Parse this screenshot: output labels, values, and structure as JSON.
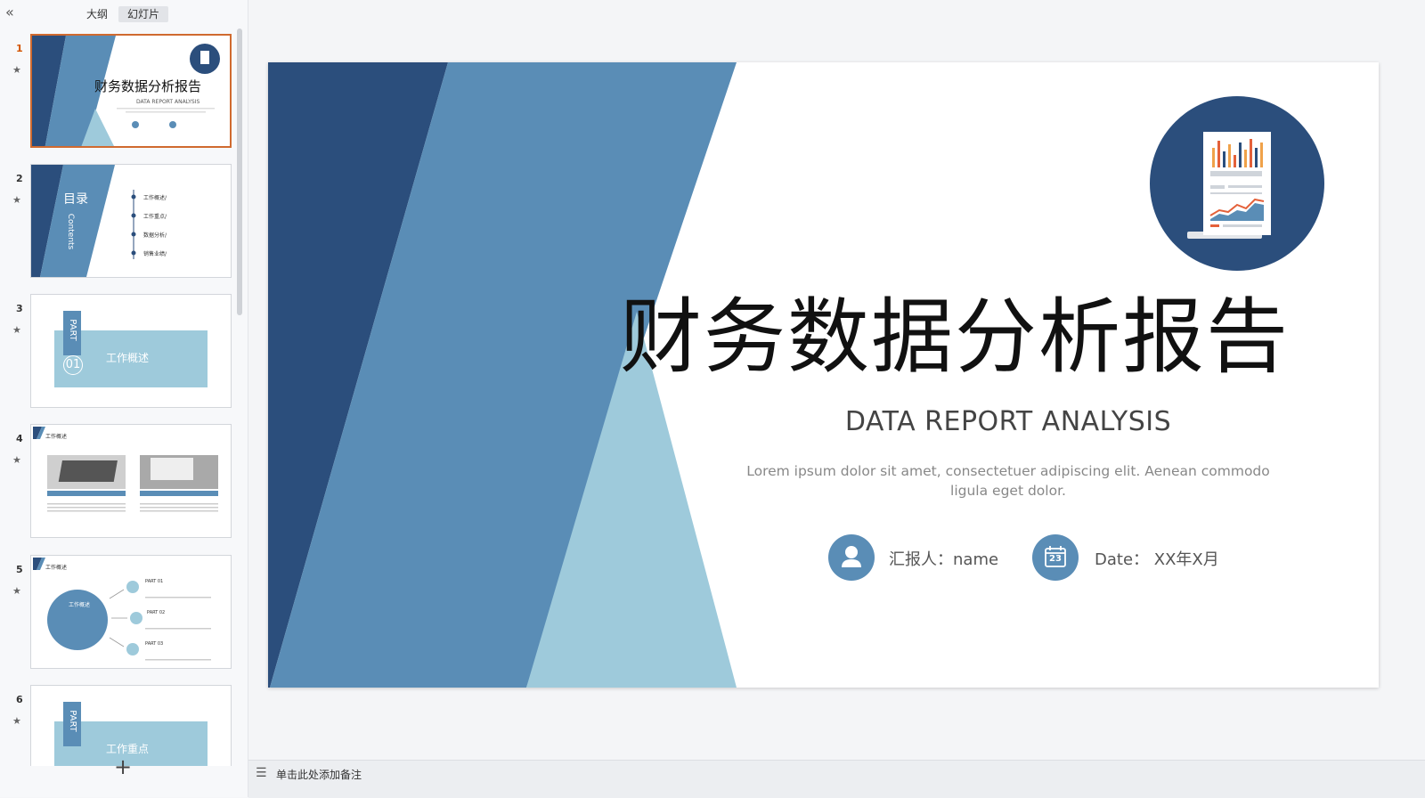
{
  "panel": {
    "tabs": [
      {
        "label": "大纲"
      },
      {
        "label": "幻灯片"
      }
    ],
    "collapse_icon": "«",
    "add_icon": "+"
  },
  "thumbnails": [
    {
      "number": "1",
      "title": "财务数据分析报告",
      "subtitle": "DATA REPORT ANALYSIS"
    },
    {
      "number": "2",
      "title": "目录",
      "subtitle": "Contents",
      "items": [
        "工作概述/",
        "工作重点/",
        "数据分析/",
        "销售业绩/"
      ]
    },
    {
      "number": "3",
      "part": "PART",
      "part_num": "01",
      "title": "工作概述"
    },
    {
      "number": "4",
      "header": "工作概述"
    },
    {
      "number": "5",
      "header": "工作概述",
      "circle_label": "工作概述",
      "parts": [
        "PART 01",
        "PART 02",
        "PART 03"
      ]
    },
    {
      "number": "6",
      "part": "PART",
      "title": "工作重点"
    }
  ],
  "slide": {
    "title": "财务数据分析报告",
    "subtitle": "DATA REPORT ANALYSIS",
    "description": "Lorem ipsum dolor sit amet, consectetuer adipiscing elit. Aenean commodo ligula eget dolor.",
    "reporter": "汇报人：name",
    "date": "Date： XX年X月",
    "calendar_day": "23"
  },
  "notes": {
    "placeholder": "单击此处添加备注"
  },
  "colors": {
    "dark_blue": "#2b4e7c",
    "mid_blue": "#5a8db6",
    "light_blue": "#9ecadb",
    "active_border": "#d06a2f"
  }
}
